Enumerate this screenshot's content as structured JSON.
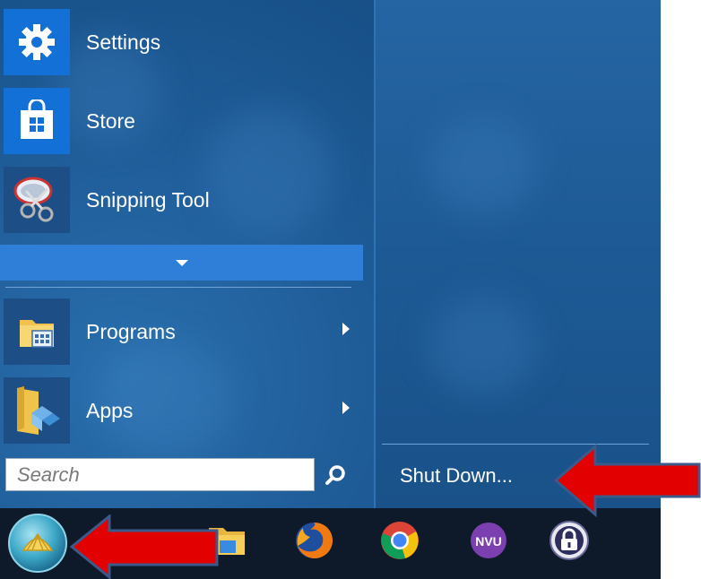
{
  "start_menu": {
    "pinned": [
      {
        "label": "Settings",
        "icon": "gear-icon"
      },
      {
        "label": "Store",
        "icon": "store-bag-icon"
      },
      {
        "label": "Snipping Tool",
        "icon": "scissors-icon"
      }
    ],
    "expand_icon": "chevron-down-icon",
    "folders": [
      {
        "label": "Programs",
        "icon": "programs-folder-icon",
        "has_submenu": true
      },
      {
        "label": "Apps",
        "icon": "apps-folder-icon",
        "has_submenu": true
      }
    ],
    "search": {
      "placeholder": "Search",
      "value": ""
    },
    "shutdown_label": "Shut Down..."
  },
  "taskbar": {
    "items": [
      "start-orb",
      "task-view",
      "file-explorer",
      "firefox",
      "chrome",
      "nvu",
      "keepass"
    ],
    "nvu_label": "NVU"
  },
  "colors": {
    "menu_bg": "#1b5690",
    "tile_blue": "#1370d6",
    "expand_bar": "#2f7fd8",
    "taskbar_bg": "#0e1a2a",
    "annotation_arrow": "#e30000"
  }
}
